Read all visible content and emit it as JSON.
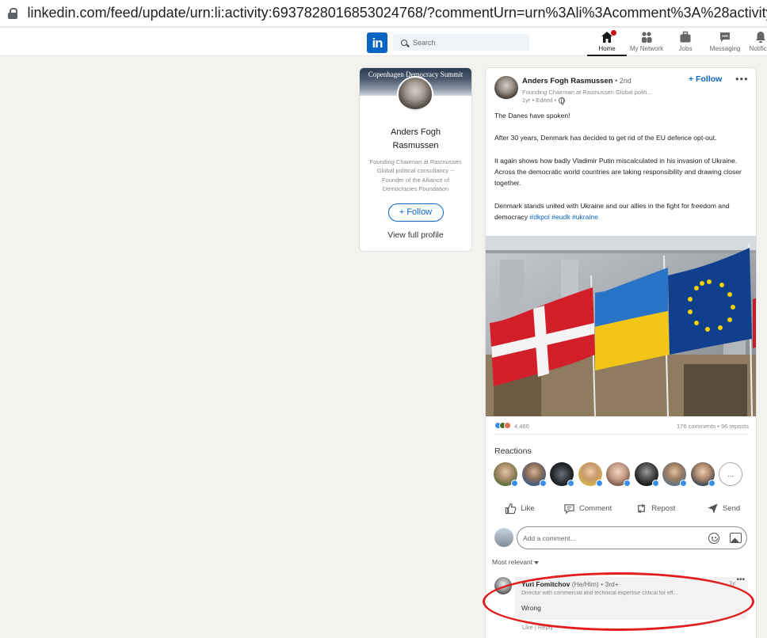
{
  "browser": {
    "url": "linkedin.com/feed/update/urn:li:activity:6937828016853024768/?commentUrn=urn%3Ali%3Acomment%3A%28activity%3"
  },
  "nav": {
    "logo_text": "in",
    "search_placeholder": "Search",
    "items": [
      {
        "label": "Home",
        "icon": "home-icon"
      },
      {
        "label": "My Network",
        "icon": "network-icon"
      },
      {
        "label": "Jobs",
        "icon": "briefcase-icon"
      },
      {
        "label": "Messaging",
        "icon": "messaging-icon"
      },
      {
        "label": "Notificat",
        "icon": "bell-icon"
      }
    ]
  },
  "profile_card": {
    "banner_text": "Copenhagen Democracy Summit",
    "name": "Anders Fogh Rasmussen",
    "headline": "Founding Chairman at Rasmussen Global political consultancy -- Founder of the Alliance of Democracies Foundation",
    "follow_label": "+ Follow",
    "view_profile_label": "View full profile"
  },
  "post": {
    "author": "Anders Fogh Rasmussen",
    "degree": " • 2nd",
    "headline": "Founding Chairman at Rasmussen Global politi...",
    "time": "1yr • Edited •",
    "follow_label": "+ Follow",
    "more_label": "•••",
    "body": {
      "p1": "The Danes have spoken!",
      "p2": "After 30 years, Denmark has decided to get rid of the EU defence opt-out.",
      "p3": "It again shows how badly Vladimir Putin miscalculated in his invasion of Ukraine. Across the democratic world countries are taking responsibility and drawing closer together.",
      "p4": "Denmark stands united with Ukraine and our allies in the fight for freedom and democracy ",
      "hashtags": [
        "#dkpol",
        "#eudk",
        "#ukraine"
      ]
    },
    "reactions_count": "4,460",
    "comments_reposts": "176 comments • 96 reposts",
    "reactions_title": "Reactions",
    "more_reactors": "...",
    "actions": [
      "Like",
      "Comment",
      "Repost",
      "Send"
    ],
    "comment_placeholder": "Add a comment...",
    "sort_label": "Most relevant"
  },
  "comment": {
    "name": "Yuri Fomitchov",
    "pronouns": " (He/Him)",
    "degree": " • 3rd+",
    "headline": "Director with commercial and technical expertise critical for eff...",
    "text": "Wrong",
    "time": "1y",
    "more": "•••",
    "actions": "Like  |  Reply"
  },
  "colors": {
    "accent": "#0a66c2",
    "highlight": "#e11d1d"
  }
}
